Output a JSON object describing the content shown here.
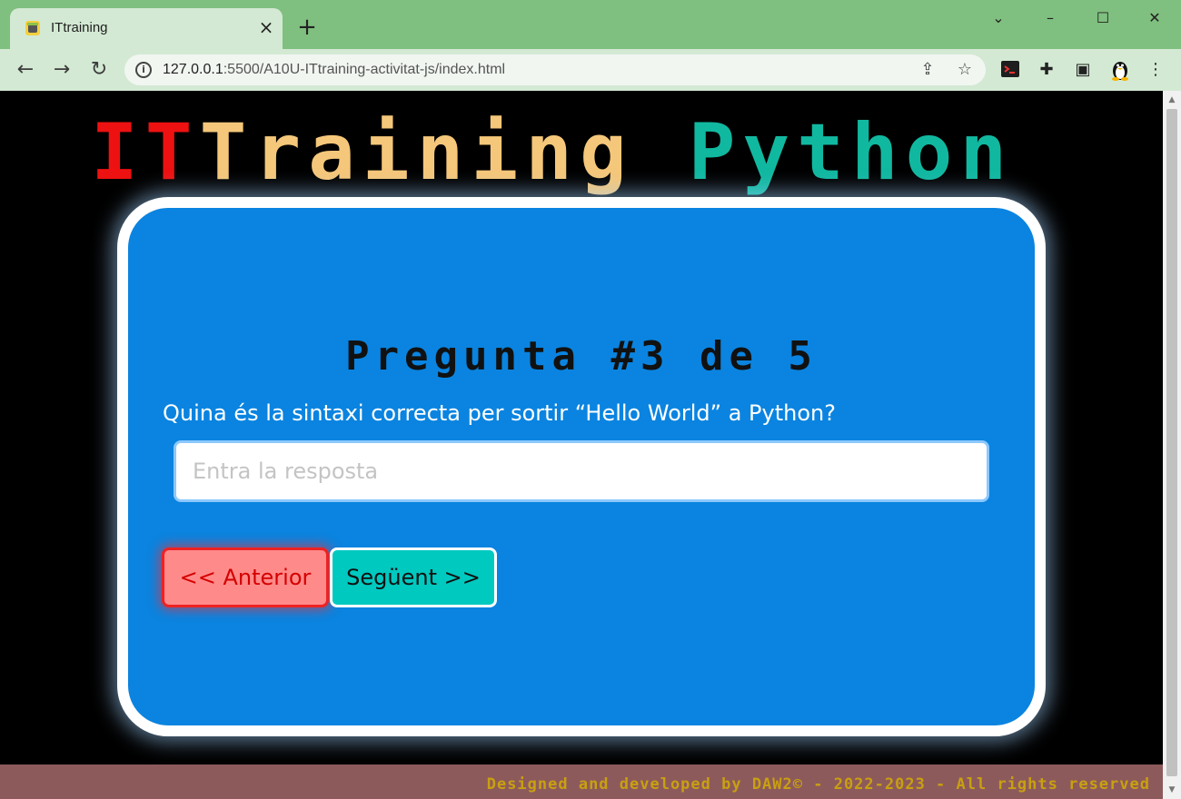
{
  "browser": {
    "tab_title": "ITtraining",
    "url_host": "127.0.0.1",
    "url_rest": ":5500/A10U-ITtraining-activitat-js/index.html",
    "icons": {
      "back": "back-arrow-icon",
      "forward": "forward-arrow-icon",
      "reload": "reload-icon",
      "info": "info-icon",
      "share": "share-icon",
      "bookmark": "star-icon",
      "terminal": "terminal-extension-icon",
      "extensions": "puzzle-icon",
      "sidepanel": "side-panel-icon",
      "profile": "tux-profile-icon",
      "menu": "kebab-menu-icon"
    }
  },
  "page": {
    "title_part1": "IT",
    "title_part2": "Training",
    "title_part3": "Python",
    "question_heading": "Pregunta #3 de 5",
    "question_text": "Quina és la sintaxi correcta per sortir “Hello World” a Python?",
    "answer_placeholder": "Entra la resposta",
    "answer_value": "",
    "prev_button": "<< Anterior",
    "next_button": "Següent >>",
    "footer": "Designed and developed by DAW2© - 2022-2023 - All rights reserved"
  },
  "colors": {
    "title_red": "#ee1111",
    "title_amber": "#f5c77a",
    "title_teal": "#11b8a0",
    "card_blue": "#0a84e0",
    "prev_bg": "#ff8a8a",
    "next_bg": "#00c9c0",
    "footer_bg": "#8d5a5c",
    "footer_text": "#c8a010"
  }
}
